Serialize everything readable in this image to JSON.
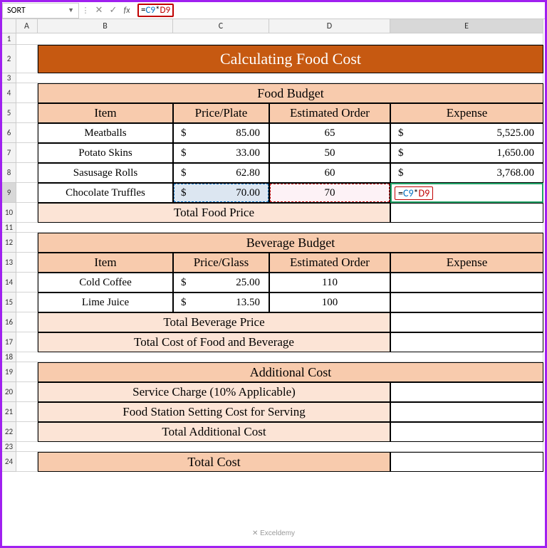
{
  "nameBox": "SORT",
  "formula": {
    "eq": "=",
    "ref1": "C9",
    "op": "*",
    "ref2": "D9"
  },
  "cols": [
    "A",
    "B",
    "C",
    "D",
    "E"
  ],
  "title": "Calculating Food Cost",
  "food": {
    "header": "Food Budget",
    "cols": {
      "item": "Item",
      "price": "Price/Plate",
      "order": "Estimated Order",
      "exp": "Expense"
    },
    "rows": [
      {
        "item": "Meatballs",
        "price": "85.00",
        "order": "65",
        "exp": "5,525.00"
      },
      {
        "item": "Potato Skins",
        "price": "33.00",
        "order": "50",
        "exp": "1,650.00"
      },
      {
        "item": "Sasusage Rolls",
        "price": "62.80",
        "order": "60",
        "exp": "3,768.00"
      },
      {
        "item": "Chocolate Truffles",
        "price": "70.00",
        "order": "70",
        "exp": ""
      }
    ],
    "total": "Total Food Price"
  },
  "bev": {
    "header": "Beverage Budget",
    "cols": {
      "item": "Item",
      "price": "Price/Glass",
      "order": "Estimated Order",
      "exp": "Expense"
    },
    "rows": [
      {
        "item": "Cold Coffee",
        "price": "25.00",
        "order": "110"
      },
      {
        "item": "Lime Juice",
        "price": "13.50",
        "order": "100"
      }
    ],
    "total1": "Total Beverage Price",
    "total2": "Total Cost of Food and Beverage"
  },
  "add": {
    "header": "Additional Cost",
    "r1": "Service Charge (10% Applicable)",
    "r2": "Food Station Setting Cost for Serving",
    "r3": "Total Additional Cost"
  },
  "final": "Total Cost",
  "dollar": "$",
  "watermark": "✕ Exceldemy"
}
